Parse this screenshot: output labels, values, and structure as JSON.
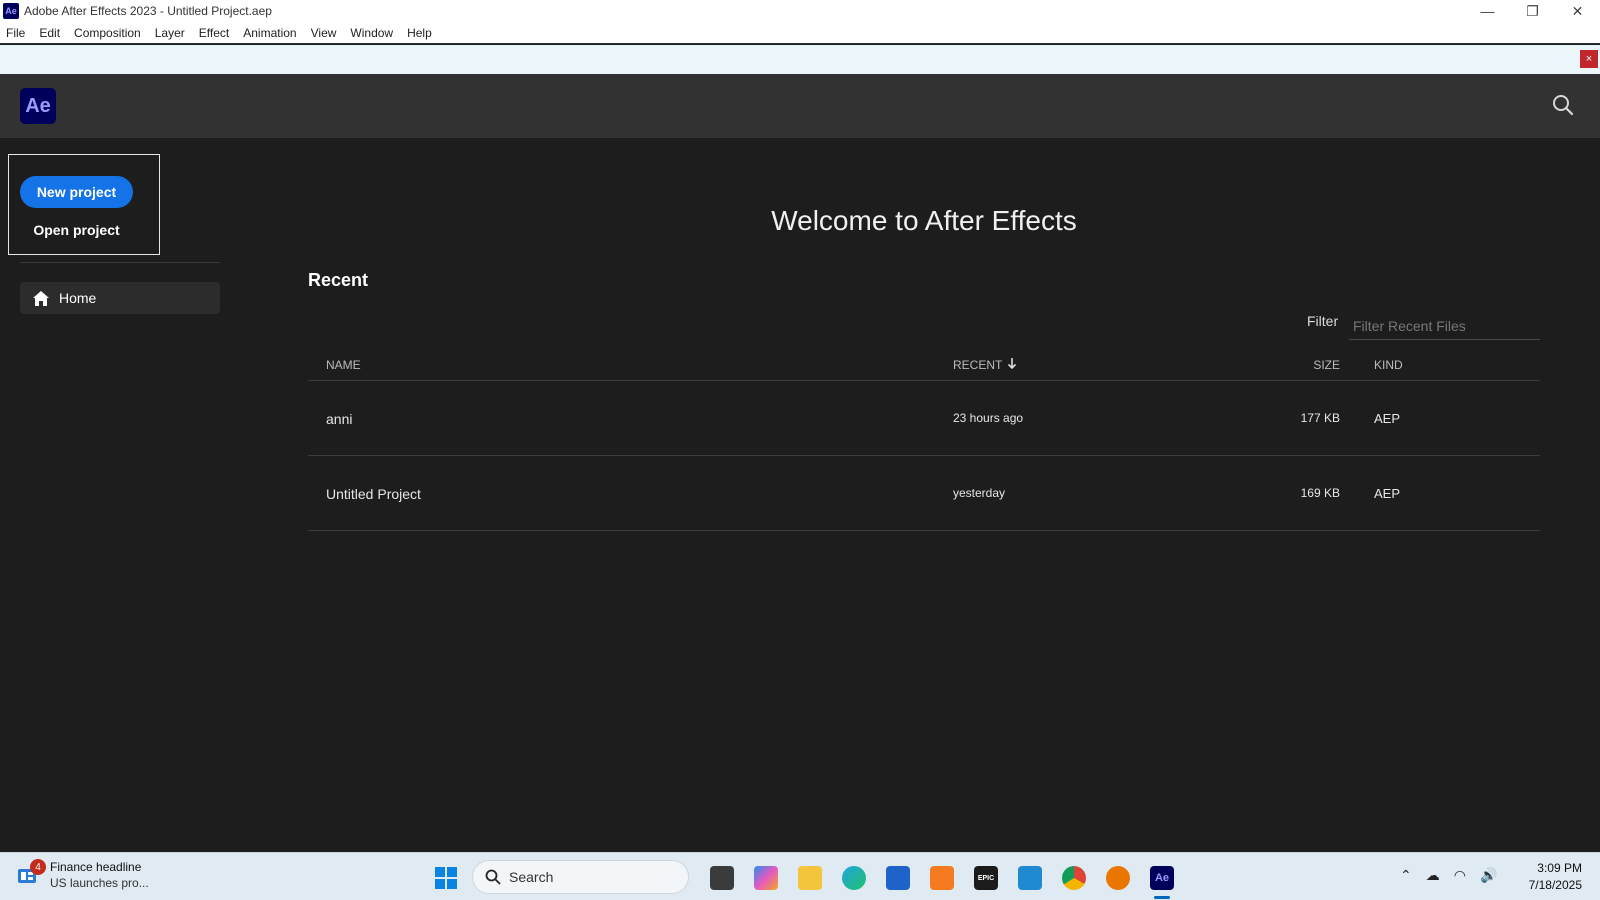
{
  "window": {
    "title": "Adobe After Effects 2023 - Untitled Project.aep",
    "app_icon_text": "Ae",
    "minimize": "—",
    "restore": "❐",
    "close": "✕"
  },
  "menu": [
    "File",
    "Edit",
    "Composition",
    "Layer",
    "Effect",
    "Animation",
    "View",
    "Window",
    "Help"
  ],
  "notification": {
    "close": "×"
  },
  "header": {
    "logo": "Ae",
    "search_icon": "search-icon"
  },
  "sidebar": {
    "new_project": "New project",
    "open_project": "Open project",
    "nav": [
      {
        "label": "Home",
        "icon": "home-icon"
      }
    ]
  },
  "main": {
    "welcome": "Welcome to After Effects",
    "recent_heading": "Recent",
    "filter_label": "Filter",
    "filter_placeholder": "Filter Recent Files",
    "columns": {
      "name": "NAME",
      "recent": "RECENT",
      "size": "SIZE",
      "kind": "KIND"
    },
    "files": [
      {
        "name": "anni",
        "recent": "23 hours ago",
        "size": "177 KB",
        "kind": "AEP"
      },
      {
        "name": "Untitled Project",
        "recent": "yesterday",
        "size": "169 KB",
        "kind": "AEP"
      }
    ]
  },
  "taskbar": {
    "news_badge": "4",
    "news_title": "Finance headline",
    "news_sub": "US launches pro...",
    "search_label": "Search",
    "apps": [
      "file-explorer",
      "copilot",
      "folder",
      "edge",
      "store",
      "xampp",
      "epic-games",
      "vscode",
      "chrome",
      "blender",
      "after-effects"
    ],
    "app_labels": {
      "epic": "EPIC",
      "ae": "Ae"
    },
    "time": "3:09 PM",
    "date": "7/18/2025"
  },
  "colors": {
    "accent": "#1473e6",
    "bg": "#1d1d1d",
    "header": "#323232",
    "ae_purple": "#00005b"
  }
}
